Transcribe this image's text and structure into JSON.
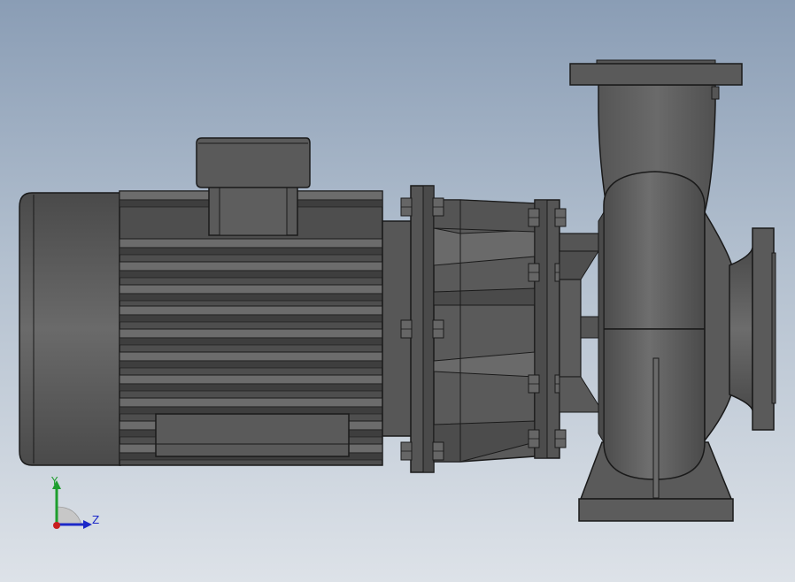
{
  "viewport": {
    "background_top": "#8a9db5",
    "background_bottom": "#dde2e8",
    "model": "centrifugal-pump-assembly",
    "view_orientation": "right"
  },
  "triad": {
    "y_label": "Y",
    "z_label": "Z",
    "y_color": "#1e9e2e",
    "z_color": "#1c28c8",
    "x_color": "#c81e1e"
  },
  "colors": {
    "part_fill": "#5c5c5c",
    "part_dark": "#3c3c3c",
    "part_light": "#777777",
    "edge": "#1a1a1a"
  }
}
